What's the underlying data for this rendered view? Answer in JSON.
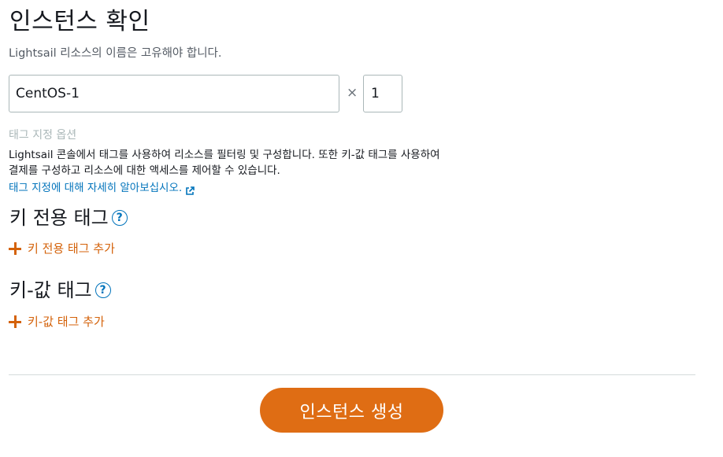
{
  "page": {
    "title": "인스턴스 확인",
    "hint": "Lightsail 리소스의 이름은 고유해야 합니다."
  },
  "instance": {
    "name_value": "CentOS-1",
    "multiplier_symbol": "×",
    "count_value": "1"
  },
  "tags": {
    "options_title": "태그 지정 옵션",
    "description_line1": "Lightsail 콘솔에서 태그를 사용하여 리소스를 필터링 및 구성합니다. 또한 키-값 태그를 사용하여",
    "description_line2": "결제를 구성하고 리소스에 대한 액세스를 제어할 수 있습니다.",
    "learn_more_link": "태그 지정에 대해 자세히 알아보십시오.",
    "key_only": {
      "title": "키 전용 태그",
      "help_symbol": "?",
      "add_label": "키 전용 태그 추가"
    },
    "key_value": {
      "title": "키-값 태그",
      "help_symbol": "?",
      "add_label": "키-값 태그 추가"
    }
  },
  "footer": {
    "create_button_label": "인스턴스 생성"
  },
  "colors": {
    "accent_orange": "#df6d14",
    "link_orange": "#d4620a",
    "link_blue": "#0073bb",
    "muted_gray": "#aab7b8"
  },
  "icons": {
    "help": "help-circle-icon",
    "add": "plus-icon",
    "external": "external-link-icon"
  }
}
